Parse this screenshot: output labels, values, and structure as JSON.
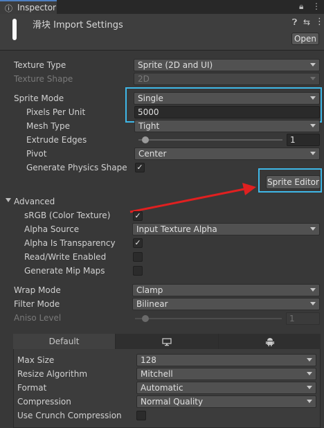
{
  "tab": {
    "label": "Inspector"
  },
  "header": {
    "title": "滑块 Import Settings",
    "open_button": "Open"
  },
  "rows": {
    "texture_type": {
      "label": "Texture Type",
      "value": "Sprite (2D and UI)"
    },
    "texture_shape": {
      "label": "Texture Shape",
      "value": "2D"
    },
    "sprite_mode": {
      "label": "Sprite Mode",
      "value": "Single"
    },
    "pixels_per_unit": {
      "label": "Pixels Per Unit",
      "value": "5000"
    },
    "mesh_type": {
      "label": "Mesh Type",
      "value": "Tight"
    },
    "extrude_edges": {
      "label": "Extrude Edges",
      "value": "1",
      "slider_fraction": 0.05
    },
    "pivot": {
      "label": "Pivot",
      "value": "Center"
    },
    "generate_physics_shape": {
      "label": "Generate Physics Shape",
      "checked": "✓"
    },
    "sprite_editor_button": "Sprite Editor"
  },
  "advanced": {
    "label": "Advanced",
    "srgb": {
      "label": "sRGB (Color Texture)",
      "checked": "✓"
    },
    "alpha_source": {
      "label": "Alpha Source",
      "value": "Input Texture Alpha"
    },
    "alpha_is_transparency": {
      "label": "Alpha Is Transparency",
      "checked": "✓"
    },
    "read_write": {
      "label": "Read/Write Enabled",
      "checked": ""
    },
    "mip_maps": {
      "label": "Generate Mip Maps",
      "checked": ""
    }
  },
  "wrap": {
    "label": "Wrap Mode",
    "value": "Clamp"
  },
  "filter": {
    "label": "Filter Mode",
    "value": "Bilinear"
  },
  "aniso": {
    "label": "Aniso Level",
    "value": "1",
    "slider_fraction": 0.07
  },
  "platform": {
    "tabs": [
      "Default"
    ],
    "max_size": {
      "label": "Max Size",
      "value": "128"
    },
    "resize": {
      "label": "Resize Algorithm",
      "value": "Mitchell"
    },
    "format": {
      "label": "Format",
      "value": "Automatic"
    },
    "compression": {
      "label": "Compression",
      "value": "Normal Quality"
    },
    "crunch": {
      "label": "Use Crunch Compression",
      "checked": ""
    }
  },
  "colors": {
    "highlight": "#3fb8e8",
    "arrow": "#e02020"
  }
}
